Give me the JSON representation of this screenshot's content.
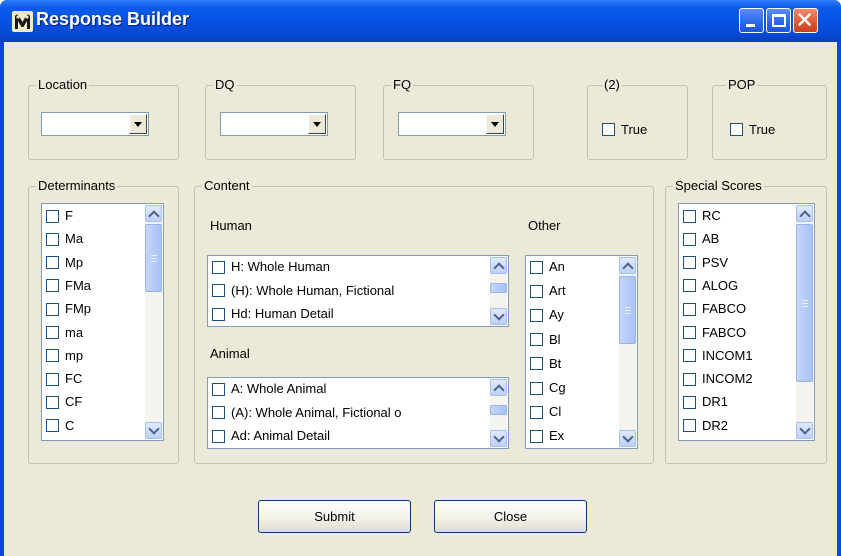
{
  "window": {
    "title": "Response Builder"
  },
  "location": {
    "legend": "Location",
    "value": ""
  },
  "dq": {
    "legend": "DQ",
    "value": ""
  },
  "fq": {
    "legend": "FQ",
    "value": ""
  },
  "pair": {
    "legend": "(2)",
    "checkbox_label": "True",
    "checked": false
  },
  "pop": {
    "legend": "POP",
    "checkbox_label": "True",
    "checked": false
  },
  "determinants": {
    "legend": "Determinants",
    "items": [
      "F",
      "Ma",
      "Mp",
      "FMa",
      "FMp",
      "ma",
      "mp",
      "FC",
      "CF",
      "C"
    ]
  },
  "content": {
    "legend": "Content",
    "human": {
      "label": "Human",
      "items": [
        "H: Whole Human",
        "(H): Whole Human, Fictional",
        "Hd: Human Detail"
      ]
    },
    "animal": {
      "label": "Animal",
      "items": [
        "A: Whole Animal",
        "(A): Whole Animal, Fictional o",
        "Ad: Animal Detail"
      ]
    },
    "other": {
      "label": "Other",
      "items": [
        "An",
        "Art",
        "Ay",
        "Bl",
        "Bt",
        "Cg",
        "Cl",
        "Ex"
      ]
    }
  },
  "special_scores": {
    "legend": "Special Scores",
    "items": [
      "RC",
      "AB",
      "PSV",
      "ALOG",
      "FABCO",
      "FABCO",
      "INCOM1",
      "INCOM2",
      "DR1",
      "DR2"
    ]
  },
  "buttons": {
    "submit": "Submit",
    "close": "Close"
  },
  "colors": {
    "titlebar": "#0552e3",
    "dialog_bg": "#ece9d8",
    "close_button": "#e05a38"
  }
}
